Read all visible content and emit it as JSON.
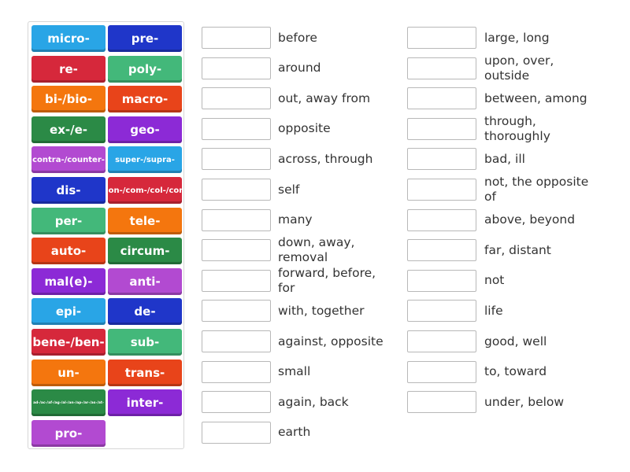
{
  "colors": {
    "cyan": "#29a5e6",
    "blue": "#1f36c9",
    "red": "#d6283b",
    "green": "#43b87a",
    "orange": "#f4760e",
    "orange_red": "#e8441a",
    "dark_green": "#2b8a46",
    "purple": "#8c2ad6",
    "violet": "#b24ad1",
    "slot_border": "#b8b8b8",
    "text": "#333333"
  },
  "tiles": [
    {
      "label": "micro-",
      "color": "cyan"
    },
    {
      "label": "pre-",
      "color": "blue"
    },
    {
      "label": "re-",
      "color": "red"
    },
    {
      "label": "poly-",
      "color": "green"
    },
    {
      "label": "bi-/bio-",
      "color": "orange"
    },
    {
      "label": "macro-",
      "color": "orange_red"
    },
    {
      "label": "ex-/e-",
      "color": "dark_green"
    },
    {
      "label": "geo-",
      "color": "purple"
    },
    {
      "label": "contra-/counter-",
      "color": "violet"
    },
    {
      "label": "super-/supra-",
      "color": "cyan"
    },
    {
      "label": "dis-",
      "color": "blue"
    },
    {
      "label": "con-/com-/col-/cor-",
      "color": "red"
    },
    {
      "label": "per-",
      "color": "green"
    },
    {
      "label": "tele-",
      "color": "orange"
    },
    {
      "label": "auto-",
      "color": "orange_red"
    },
    {
      "label": "circum-",
      "color": "dark_green"
    },
    {
      "label": "mal(e)-",
      "color": "purple"
    },
    {
      "label": "anti-",
      "color": "violet"
    },
    {
      "label": "epi-",
      "color": "cyan"
    },
    {
      "label": "de-",
      "color": "blue"
    },
    {
      "label": "bene-/ben-",
      "color": "red"
    },
    {
      "label": "sub-",
      "color": "green"
    },
    {
      "label": "un-",
      "color": "orange"
    },
    {
      "label": "trans-",
      "color": "orange_red"
    },
    {
      "label": "ad-/ac-/af-/ag-/al-/an-/ap-/ar-/as-/at-",
      "color": "dark_green"
    },
    {
      "label": "inter-",
      "color": "purple"
    },
    {
      "label": "pro-",
      "color": "violet"
    }
  ],
  "definitions_left": [
    "before",
    "around",
    "out, away from",
    "opposite",
    "across, through",
    "self",
    "many",
    "down, away, removal",
    "forward, before, for",
    "with, together",
    "against, opposite",
    "small",
    "again, back",
    "earth"
  ],
  "definitions_right": [
    "large, long",
    "upon, over, outside",
    "between, among",
    "through, thoroughly",
    "bad, ill",
    "not, the opposite of",
    "above, beyond",
    "far, distant",
    "not",
    "life",
    "good, well",
    "to, toward",
    "under, below"
  ]
}
